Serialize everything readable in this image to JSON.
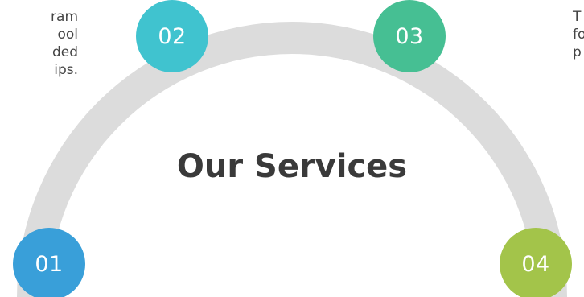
{
  "title": "Our Services",
  "colors": {
    "arc": "#dcdcdc",
    "node_01": "#399fd9",
    "node_02": "#40c3cf",
    "node_03": "#46bf93",
    "node_04": "#a3c44a",
    "title": "#3a3a3a",
    "body_text": "#444444"
  },
  "steps": [
    {
      "number": "01"
    },
    {
      "number": "02"
    },
    {
      "number": "03"
    },
    {
      "number": "04"
    }
  ],
  "descriptions": {
    "left_partial": "ram\nool\nded\nips.",
    "right_partial": "T\nfo\np"
  }
}
